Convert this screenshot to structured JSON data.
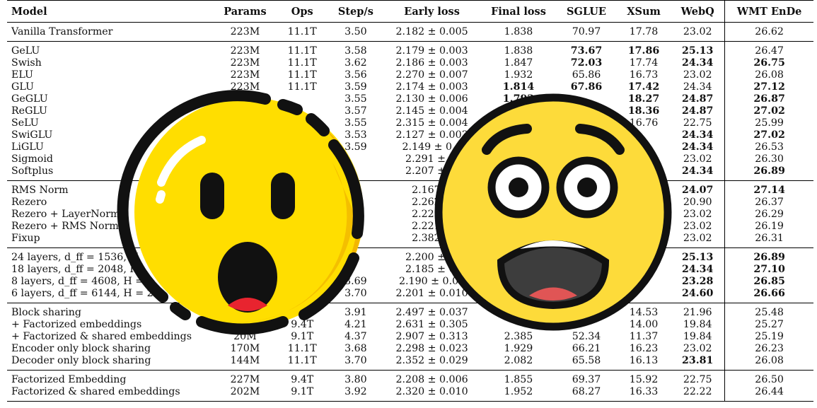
{
  "columns": [
    "Model",
    "Params",
    "Ops",
    "Step/s",
    "Early loss",
    "Final loss",
    "SGLUE",
    "XSum",
    "WebQ",
    "WMT EnDe"
  ],
  "groups": [
    [
      {
        "cells": [
          "Vanilla Transformer",
          "223M",
          "11.1T",
          "3.50",
          "2.182 ± 0.005",
          "1.838",
          "70.97",
          "17.78",
          "23.02",
          "26.62"
        ],
        "bold": []
      }
    ],
    [
      {
        "cells": [
          "GeLU",
          "223M",
          "11.1T",
          "3.58",
          "2.179 ± 0.003",
          "1.838",
          "73.67",
          "17.86",
          "25.13",
          "26.47"
        ],
        "bold": [
          6,
          7,
          8
        ]
      },
      {
        "cells": [
          "Swish",
          "223M",
          "11.1T",
          "3.62",
          "2.186 ± 0.003",
          "1.847",
          "72.03",
          "17.74",
          "24.34",
          "26.75"
        ],
        "bold": [
          6,
          8,
          9
        ]
      },
      {
        "cells": [
          "ELU",
          "223M",
          "11.1T",
          "3.56",
          "2.270 ± 0.007",
          "1.932",
          "65.86",
          "16.73",
          "23.02",
          "26.08"
        ],
        "bold": []
      },
      {
        "cells": [
          "GLU",
          "223M",
          "11.1T",
          "3.59",
          "2.174 ± 0.003",
          "1.814",
          "67.86",
          "17.42",
          "24.34",
          "27.12"
        ],
        "bold": [
          5,
          6,
          7,
          9
        ]
      },
      {
        "cells": [
          "GeGLU",
          "",
          "",
          "3.55",
          "2.130 ± 0.006",
          "1.792",
          "",
          "18.27",
          "24.87",
          "26.87"
        ],
        "bold": [
          5,
          7,
          8,
          9
        ]
      },
      {
        "cells": [
          "ReGLU",
          "",
          "",
          "3.57",
          "2.145 ± 0.004",
          "",
          "",
          "18.36",
          "24.87",
          "27.02"
        ],
        "bold": [
          7,
          8,
          9
        ]
      },
      {
        "cells": [
          "SeLU",
          "",
          "",
          "3.55",
          "2.315 ± 0.004",
          "",
          "",
          "16.76",
          "22.75",
          "25.99"
        ],
        "bold": []
      },
      {
        "cells": [
          "SwiGLU",
          "",
          "",
          "3.53",
          "2.127 ± 0.003",
          "",
          "",
          "",
          "24.34",
          "27.02"
        ],
        "bold": [
          8,
          9
        ]
      },
      {
        "cells": [
          "LiGLU",
          "",
          "",
          "3.59",
          "2.149 ± 0.0",
          "",
          "",
          "",
          "24.34",
          "26.53"
        ],
        "bold": [
          8
        ]
      },
      {
        "cells": [
          "Sigmoid",
          "",
          "",
          "",
          "2.291 ± 0.",
          "",
          "",
          "",
          "23.02",
          "26.30"
        ],
        "bold": []
      },
      {
        "cells": [
          "Softplus",
          "",
          "",
          "",
          "2.207 ± 0.",
          "",
          "",
          "",
          "24.34",
          "26.89"
        ],
        "bold": [
          8,
          9
        ]
      }
    ],
    [
      {
        "cells": [
          "RMS Norm",
          "",
          "",
          "",
          "2.167 ±",
          "",
          "",
          "",
          "24.07",
          "27.14"
        ],
        "bold": [
          8,
          9
        ]
      },
      {
        "cells": [
          "Rezero",
          "",
          "",
          "",
          "2.262 ±",
          "",
          "",
          "",
          "20.90",
          "26.37"
        ],
        "bold": []
      },
      {
        "cells": [
          "Rezero + LayerNorm",
          "",
          "",
          "",
          "2.223 ±",
          "",
          "",
          "",
          "23.02",
          "26.29"
        ],
        "bold": []
      },
      {
        "cells": [
          "Rezero + RMS Norm",
          "",
          "",
          "",
          "2.221 ±",
          "",
          "",
          "",
          "23.02",
          "26.19"
        ],
        "bold": []
      },
      {
        "cells": [
          "Fixup",
          "",
          "",
          "",
          "2.382 ±",
          "",
          "",
          "",
          "23.02",
          "26.31"
        ],
        "bold": []
      }
    ],
    [
      {
        "cells": [
          "24 layers, d_ff = 1536, H",
          "",
          "",
          "",
          "2.200 ± 0.",
          "",
          "",
          "",
          "25.13",
          "26.89"
        ],
        "bold": [
          8,
          9
        ]
      },
      {
        "cells": [
          "18 layers, d_ff = 2048, H",
          "",
          "",
          "",
          "2.185 ± 0.",
          "",
          "",
          "",
          "24.34",
          "27.10"
        ],
        "bold": [
          8,
          9
        ]
      },
      {
        "cells": [
          "8 layers, d_ff = 4608, H =",
          "",
          "",
          "3.69",
          "2.190 ± 0.00",
          "",
          "",
          "",
          "23.28",
          "26.85"
        ],
        "bold": [
          8,
          9
        ]
      },
      {
        "cells": [
          "6 layers, d_ff = 6144, H = 24",
          "",
          "",
          "3.70",
          "2.201 ± 0.010",
          "",
          "",
          "",
          "24.60",
          "26.66"
        ],
        "bold": [
          8,
          9
        ]
      }
    ],
    [
      {
        "cells": [
          "Block sharing",
          "",
          "",
          "3.91",
          "2.497 ± 0.037",
          "",
          "",
          "14.53",
          "21.96",
          "25.48"
        ],
        "bold": []
      },
      {
        "cells": [
          "  + Factorized embeddings",
          "",
          "9.4T",
          "4.21",
          "2.631 ± 0.305",
          "",
          "",
          "14.00",
          "19.84",
          "25.27"
        ],
        "bold": []
      },
      {
        "cells": [
          "  + Factorized & shared embeddings",
          "20M",
          "9.1T",
          "4.37",
          "2.907 ± 0.313",
          "2.385",
          "52.34",
          "11.37",
          "19.84",
          "25.19"
        ],
        "bold": []
      },
      {
        "cells": [
          "Encoder only block sharing",
          "170M",
          "11.1T",
          "3.68",
          "2.298 ± 0.023",
          "1.929",
          "66.21",
          "16.23",
          "23.02",
          "26.23"
        ],
        "bold": []
      },
      {
        "cells": [
          "Decoder only block sharing",
          "144M",
          "11.1T",
          "3.70",
          "2.352 ± 0.029",
          "2.082",
          "65.58",
          "16.13",
          "23.81",
          "26.08"
        ],
        "bold": [
          8
        ]
      }
    ],
    [
      {
        "cells": [
          "Factorized Embedding",
          "227M",
          "9.4T",
          "3.80",
          "2.208 ± 0.006",
          "1.855",
          "69.37",
          "15.92",
          "22.75",
          "26.50"
        ],
        "bold": []
      },
      {
        "cells": [
          "Factorized & shared embeddings",
          "202M",
          "9.1T",
          "3.92",
          "2.320 ± 0.010",
          "1.952",
          "68.27",
          "16.33",
          "22.22",
          "26.44"
        ],
        "bold": []
      }
    ]
  ],
  "stickers": [
    {
      "name": "shocked-emoji-left",
      "face": "#ffde00",
      "shade": "#f0b400",
      "outline": "#111111"
    },
    {
      "name": "scared-emoji-right",
      "face": "#fddb3a",
      "outline": "#111111",
      "mouth": "#3d3d3d",
      "tongue": "#e05555"
    }
  ]
}
